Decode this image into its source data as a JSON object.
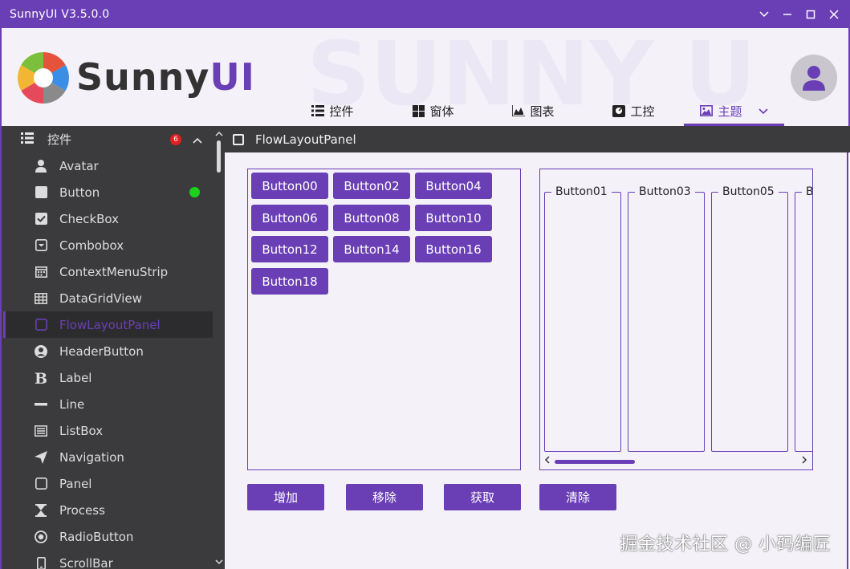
{
  "window": {
    "title": "SunnyUI V3.5.0.0",
    "controls": [
      "chevron-down-icon",
      "minimize-icon",
      "maximize-icon",
      "close-icon"
    ]
  },
  "header": {
    "logo_text_main": "Sunny",
    "logo_text_accent": "UI",
    "tabs": [
      {
        "label": "控件",
        "icon": "list-icon"
      },
      {
        "label": "窗体",
        "icon": "windows-icon"
      },
      {
        "label": "图表",
        "icon": "chart-icon"
      },
      {
        "label": "工控",
        "icon": "gauge-icon"
      },
      {
        "label": "主题",
        "icon": "image-icon",
        "active": true
      }
    ]
  },
  "sidebar": {
    "header": {
      "label": "控件",
      "badge": "6"
    },
    "items": [
      {
        "label": "Avatar",
        "icon": "user-icon"
      },
      {
        "label": "Button",
        "icon": "square-icon",
        "status": "green"
      },
      {
        "label": "CheckBox",
        "icon": "checkbox-icon"
      },
      {
        "label": "Combobox",
        "icon": "dropdown-icon"
      },
      {
        "label": "ContextMenuStrip",
        "icon": "calendar-icon"
      },
      {
        "label": "DataGridView",
        "icon": "table-icon"
      },
      {
        "label": "FlowLayoutPanel",
        "icon": "square-outline-icon",
        "selected": true
      },
      {
        "label": "HeaderButton",
        "icon": "user-circle-icon"
      },
      {
        "label": "Label",
        "icon": "bold-icon"
      },
      {
        "label": "Line",
        "icon": "minus-icon"
      },
      {
        "label": "ListBox",
        "icon": "list-box-icon"
      },
      {
        "label": "Navigation",
        "icon": "paper-plane-icon"
      },
      {
        "label": "Panel",
        "icon": "square-outline-icon"
      },
      {
        "label": "Process",
        "icon": "hourglass-icon"
      },
      {
        "label": "RadioButton",
        "icon": "radio-icon"
      },
      {
        "label": "ScrollBar",
        "icon": "mobile-icon"
      }
    ]
  },
  "content": {
    "title": "FlowLayoutPanel",
    "panel1_buttons": [
      "Button00",
      "Button02",
      "Button04",
      "Button06",
      "Button08",
      "Button10",
      "Button12",
      "Button14",
      "Button16",
      "Button18"
    ],
    "panel2_groups": [
      "Button01",
      "Button03",
      "Button05",
      "B"
    ],
    "actions": [
      "增加",
      "移除",
      "获取",
      "清除"
    ],
    "watermark": "掘金技术社区 @ 小码编匠"
  },
  "colors": {
    "accent": "#6a3fb5",
    "sidebar_bg": "#3b3b3d",
    "content_bg": "#f4f1f9",
    "status_green": "#1bd21b",
    "badge_red": "#e02020"
  }
}
